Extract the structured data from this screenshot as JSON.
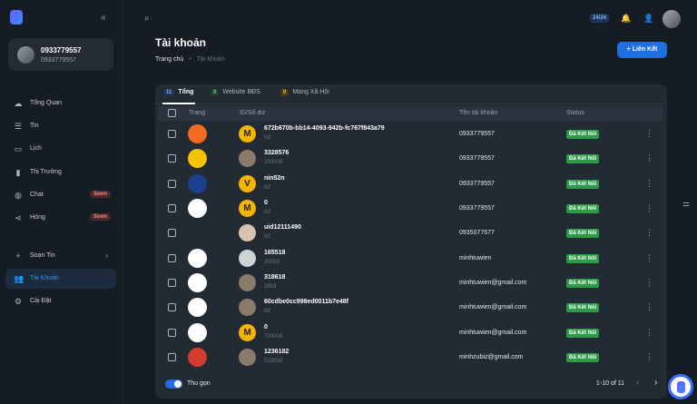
{
  "sidebar": {
    "collapse_icon": "double-chevron-left",
    "user": {
      "name": "0933779557",
      "sub": "0933779557"
    },
    "items": [
      {
        "label": "Tổng Quan",
        "icon": "cloud-icon"
      },
      {
        "label": "Tin",
        "icon": "list-icon"
      },
      {
        "label": "Lịch",
        "icon": "calendar-icon"
      },
      {
        "label": "Thị Trường",
        "icon": "bar-chart-icon"
      },
      {
        "label": "Chat",
        "icon": "chat-icon",
        "badge": "Soon"
      },
      {
        "label": "Hóng",
        "icon": "share-icon",
        "badge": "Soon"
      },
      {
        "label": "Soạn Tin",
        "icon": "plus-icon",
        "chevron": "›"
      },
      {
        "label": "Tài Khoản",
        "icon": "users-icon",
        "active": true
      },
      {
        "label": "Cài Đặt",
        "icon": "gear-icon"
      }
    ]
  },
  "topbar": {
    "pill": "24/24"
  },
  "page": {
    "title": "Tài khoản",
    "breadcrumb": {
      "home": "Trang chủ",
      "sep": "•",
      "current": "Tài khoản"
    },
    "add_button": "Liên Kết"
  },
  "tabs": [
    {
      "count": "11",
      "label": "Tổng",
      "color": "#1f3555",
      "text": "#7fb2ff"
    },
    {
      "count": "0",
      "label": "Website BĐS",
      "color": "#21402c",
      "text": "#6ed28a"
    },
    {
      "count": "0",
      "label": "Mạng Xã Hội",
      "color": "#4a3d1a",
      "text": "#f0c24b"
    }
  ],
  "table": {
    "headers": [
      "Trang",
      "ID/Số dư",
      "Tên tài khoản",
      "Status"
    ],
    "rows": [
      {
        "logo_color": "#f26b21",
        "avatar": "M",
        "avatar_color": "#f5b400",
        "id": "672b670b-bb14-4093-942b-fc767f843a79",
        "balance": "0đ",
        "account": "0933779557",
        "status": "Đã Kết Nối"
      },
      {
        "logo_color": "#f5c400",
        "avatar": "",
        "avatar_color": "#8a7a6a",
        "id": "3328576",
        "balance": "20000đ",
        "account": "0933779557",
        "status": "Đã Kết Nối"
      },
      {
        "logo_color": "#1b3f8f",
        "avatar": "V",
        "avatar_color": "#f5b400",
        "id": "nin52n",
        "balance": "0đ",
        "account": "0933779557",
        "status": "Đã Kết Nối"
      },
      {
        "logo_color": "#ffffff",
        "avatar": "M",
        "avatar_color": "#f5b400",
        "id": "0",
        "balance": "0đ",
        "account": "0933779557",
        "status": "Đã Kết Nối"
      },
      {
        "logo_color": "#222a34",
        "avatar": "",
        "avatar_color": "#d9c2b0",
        "id": "uid12111490",
        "balance": "0đ",
        "account": "0935077677",
        "status": "Đã Kết Nối"
      },
      {
        "logo_color": "#ffffff",
        "avatar": "",
        "avatar_color": "#d0d3d6",
        "id": "165518",
        "balance": "2000đ",
        "account": "minhtuwien",
        "status": "Đã Kết Nối"
      },
      {
        "logo_color": "#ffffff",
        "avatar": "",
        "avatar_color": "#8a7a6a",
        "id": "318618",
        "balance": "390đ",
        "account": "minhtuwien@gmail.com",
        "status": "Đã Kết Nối"
      },
      {
        "logo_color": "#ffffff",
        "avatar": "",
        "avatar_color": "#8a7a6a",
        "id": "60cdbe0cc998ed0011b7e48f",
        "balance": "0đ",
        "account": "minhtuwien@gmail.com",
        "status": "Đã Kết Nối"
      },
      {
        "logo_color": "#ffffff",
        "avatar": "M",
        "avatar_color": "#f5b400",
        "id": "0",
        "balance": "70000đ",
        "account": "minhtuwien@gmail.com",
        "status": "Đã Kết Nối"
      },
      {
        "logo_color": "#d63b2f",
        "avatar": "",
        "avatar_color": "#8a7a6a",
        "id": "1236182",
        "balance": "51383đ",
        "account": "minhzubiz@gmail.com",
        "status": "Đã Kết Nối"
      }
    ]
  },
  "footer": {
    "toggle_label": "Thu gọn",
    "pager": "1-10 of 11"
  }
}
